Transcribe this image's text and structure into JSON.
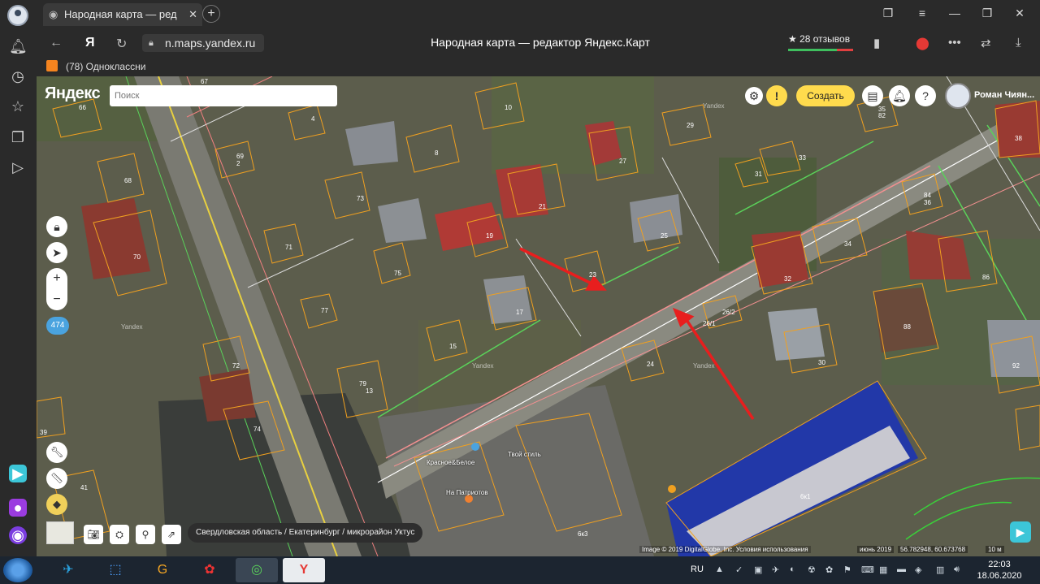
{
  "browser": {
    "tab_title": "Народная карта — ред",
    "url": "n.maps.yandex.ru",
    "page_title": "Народная карта — редактор Яндекс.Карт",
    "reviews": "★ 28 отзывов",
    "bookmark": "(78) Одноклассни"
  },
  "map": {
    "logo": "Яндекс",
    "search_placeholder": "Поиск",
    "create_label": "Создать",
    "user_name": "Роман Чиян...",
    "zoom_in": "+",
    "zoom_out": "−",
    "layer_badge": "474",
    "location_path": "Свердловская область / Екатеринбург / микрорайон Уктус",
    "copyright": "Image © 2019 DigitalGlobe, Inc. Условия использования",
    "imagery_date": "июнь 2019",
    "coordinates": "56.782948, 60.673768",
    "scale": "10 м",
    "places": [
      "Красное&Белое",
      "Твой стиль",
      "На Патриотов"
    ],
    "house_numbers": [
      "66",
      "67",
      "4",
      "10",
      "69",
      "2",
      "8",
      "27",
      "29",
      "33",
      "35",
      "82",
      "31",
      "38",
      "68",
      "73",
      "21",
      "84",
      "36",
      "34",
      "71",
      "19",
      "25",
      "70",
      "75",
      "23",
      "32",
      "86",
      "77",
      "17",
      "26/2",
      "26/1",
      "88",
      "15",
      "24",
      "30",
      "72",
      "79",
      "13",
      "92",
      "74",
      "39",
      "41",
      "6к1",
      "6к3"
    ],
    "watermark": "Yandex"
  },
  "taskbar": {
    "language": "RU",
    "time": "22:03",
    "date": "18.06.2020"
  },
  "colors": {
    "accent_yellow": "#ffdb4d",
    "arrow_red": "#e81e1e",
    "building_outline": "#f0a020",
    "taskbar": "#1c2530"
  }
}
